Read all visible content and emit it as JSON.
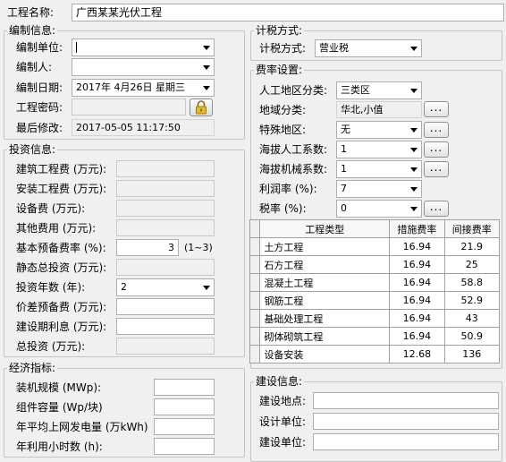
{
  "project": {
    "label": "工程名称:",
    "value": "广西某某光伏工程"
  },
  "compile": {
    "title": "编制信息:",
    "unit_label": "编制单位:",
    "unit_value": "",
    "person_label": "编制人:",
    "person_value": "",
    "date_label": "编制日期:",
    "date_value": "2017年 4月26日 星期三",
    "password_label": "工程密码:",
    "password_value": "",
    "modified_label": "最后修改:",
    "modified_value": "2017-05-05 11:17:50"
  },
  "investment": {
    "title": "投资信息:",
    "rows": [
      {
        "label": "建筑工程费 (万元):",
        "value": ""
      },
      {
        "label": "安装工程费 (万元):",
        "value": ""
      },
      {
        "label": "设备费 (万元):",
        "value": ""
      },
      {
        "label": "其他费用 (万元):",
        "value": ""
      },
      {
        "label": "基本预备费率 (%):",
        "value": "3",
        "hint": "(1~3)"
      },
      {
        "label": "静态总投资 (万元):",
        "value": ""
      },
      {
        "label": "投资年数 (年):",
        "value": "2"
      },
      {
        "label": "价差预备费 (万元):",
        "value": ""
      },
      {
        "label": "建设期利息 (万元):",
        "value": ""
      },
      {
        "label": "总投资 (万元):",
        "value": ""
      }
    ]
  },
  "economic": {
    "title": "经济指标:",
    "rows": [
      {
        "label": "装机规模 (MWp):",
        "value": ""
      },
      {
        "label": "组件容量 (Wp/块)",
        "value": ""
      },
      {
        "label": "年平均上网发电量 (万kWh)",
        "value": ""
      },
      {
        "label": "年利用小时数 (h):",
        "value": ""
      }
    ]
  },
  "tax": {
    "title": "计税方式:",
    "label": "计税方式:",
    "value": "营业税"
  },
  "fee": {
    "title": "费率设置:",
    "labor_label": "人工地区分类:",
    "labor_value": "三类区",
    "region_label": "地域分类:",
    "region_value": "华北,小值",
    "special_label": "特殊地区:",
    "special_value": "无",
    "alt_labor_label": "海拔人工系数:",
    "alt_labor_value": "1",
    "alt_mach_label": "海拔机械系数:",
    "alt_mach_value": "1",
    "profit_label": "利润率 (%):",
    "profit_value": "7",
    "taxrate_label": "税率 (%):",
    "taxrate_value": "0",
    "more_label": "...",
    "table": {
      "headers": [
        "工程类型",
        "措施费率",
        "间接费率"
      ],
      "rows": [
        [
          "土方工程",
          "16.94",
          "21.9"
        ],
        [
          "石方工程",
          "16.94",
          "25"
        ],
        [
          "混凝土工程",
          "16.94",
          "58.8"
        ],
        [
          "钢筋工程",
          "16.94",
          "52.9"
        ],
        [
          "基础处理工程",
          "16.94",
          "43"
        ],
        [
          "砌体砌筑工程",
          "16.94",
          "50.9"
        ],
        [
          "设备安装",
          "12.68",
          "136"
        ]
      ]
    }
  },
  "construction": {
    "title": "建设信息:",
    "rows": [
      {
        "label": "建设地点:",
        "value": ""
      },
      {
        "label": "设计单位:",
        "value": ""
      },
      {
        "label": "建设单位:",
        "value": ""
      }
    ]
  },
  "icons": {
    "lock": "lock-icon",
    "dropdown": "chevron-down-icon"
  }
}
